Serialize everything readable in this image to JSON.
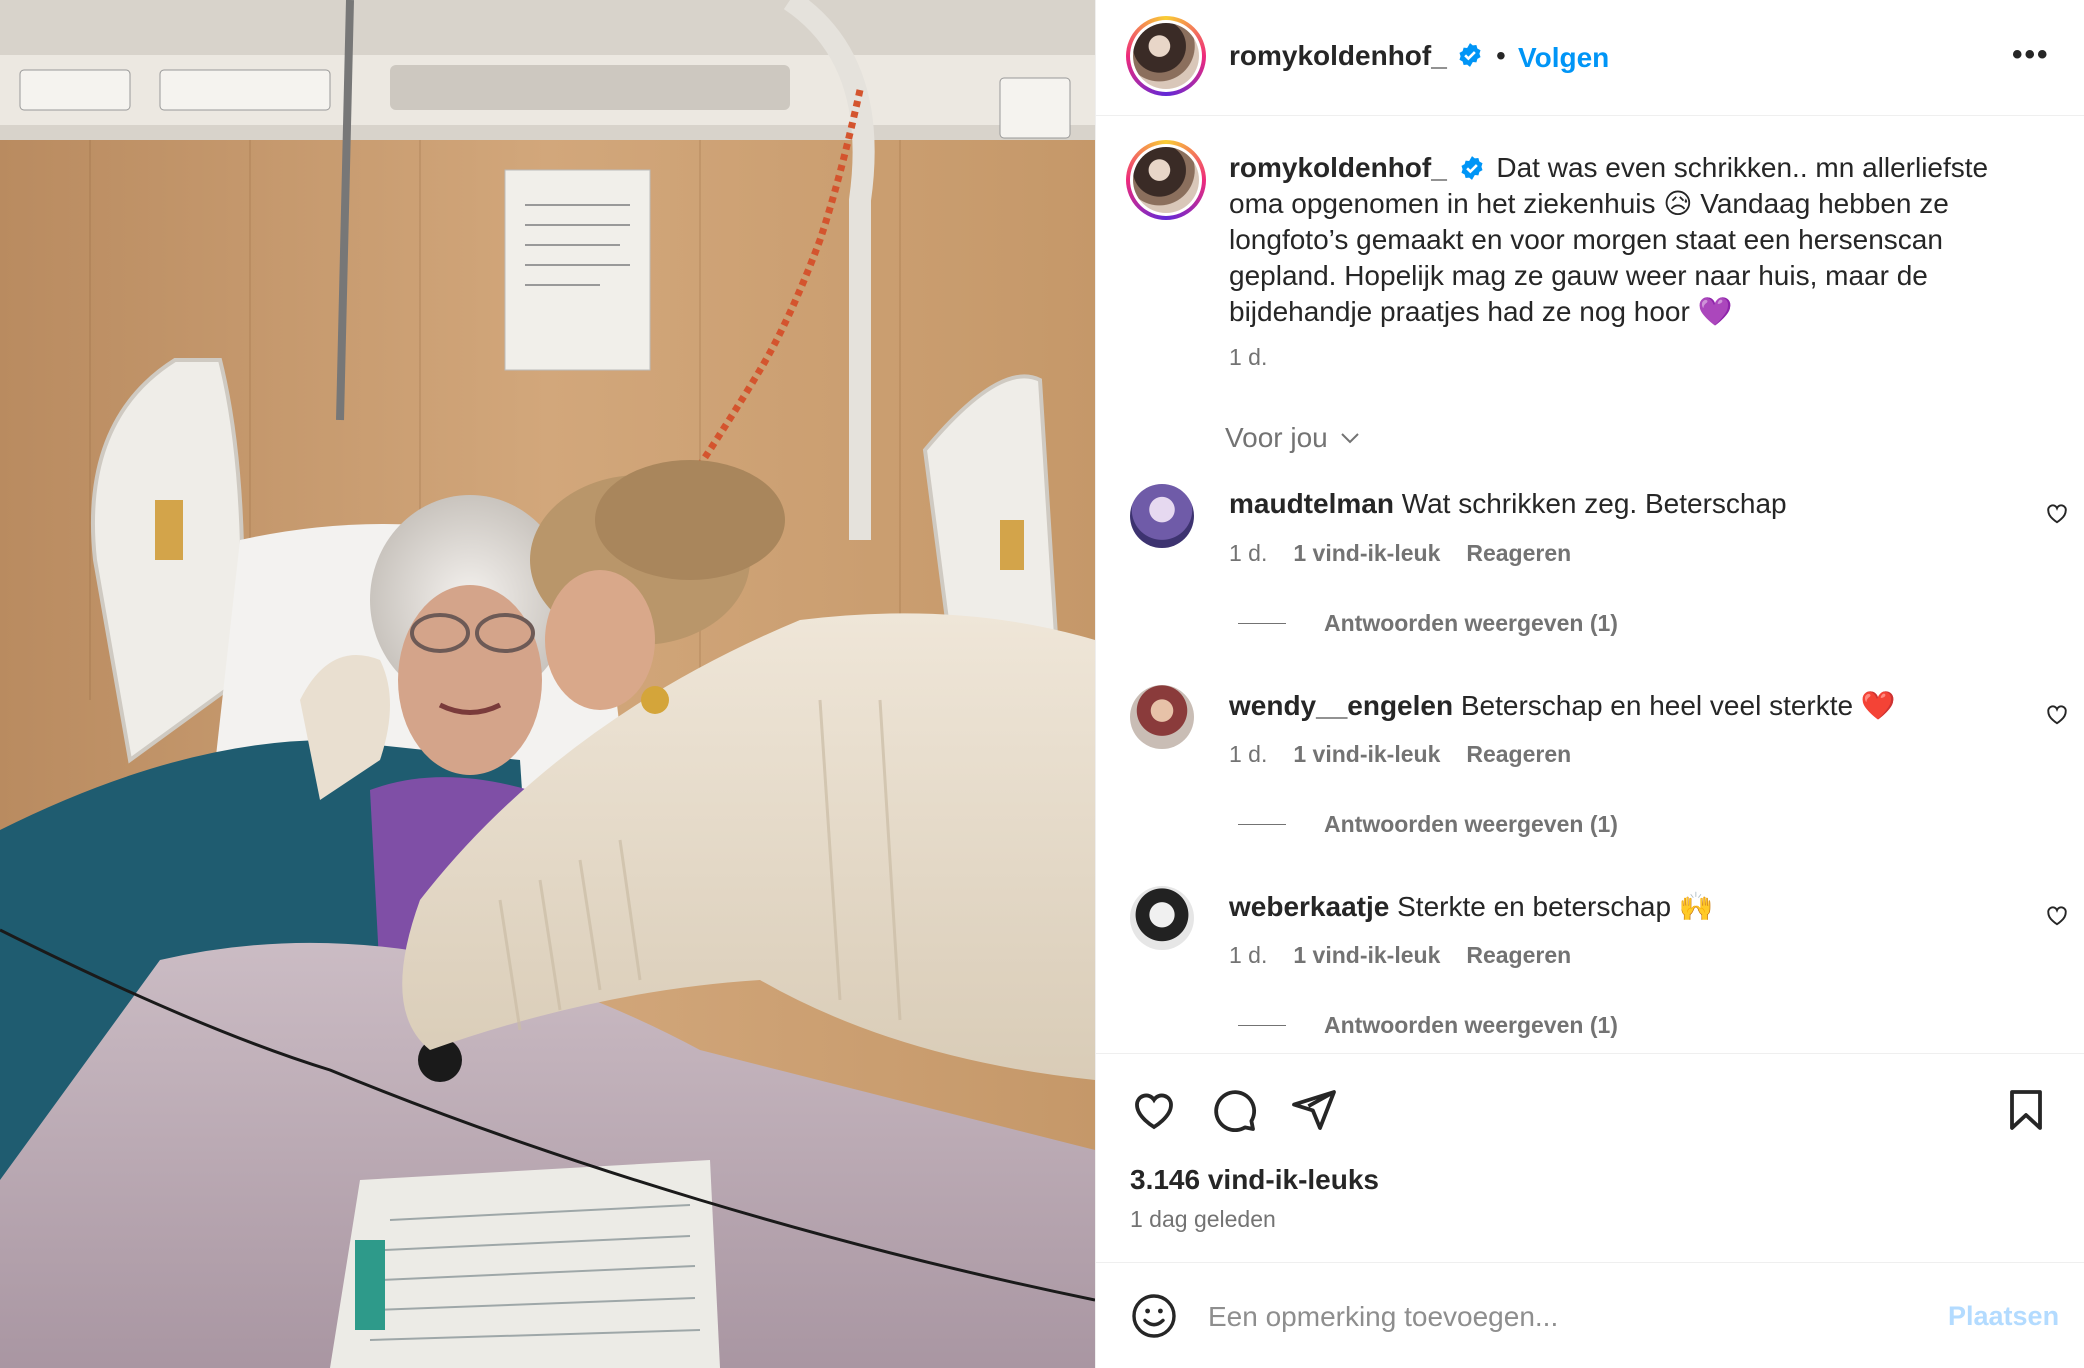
{
  "post": {
    "username": "romykoldenhof_",
    "follow_label": "Volgen",
    "dot": "•",
    "more_label": "•••",
    "caption_text": "Dat was even schrikken.. mn allerliefste oma opgenomen in het ziekenhuis 😥 Vandaag hebben ze longfoto’s gemaakt en voor morgen staat een hersenscan gepland. Hopelijk mag ze gauw weer naar huis, maar de bijdehandje praatjes had ze nog hoor 💜",
    "caption_time": "1 d.",
    "for_you_label": "Voor jou",
    "likes": "3.146 vind-ik-leuks",
    "posted_ago": "1 dag geleden"
  },
  "comments": [
    {
      "username": "maudtelman",
      "text": "Wat schrikken zeg. Beterschap",
      "time": "1 d.",
      "likes": "1 vind-ik-leuk",
      "reply": "Reageren",
      "view_replies": "Antwoorden weergeven (1)"
    },
    {
      "username": "wendy__engelen",
      "text": "Beterschap en heel veel sterkte ❤️",
      "time": "1 d.",
      "likes": "1 vind-ik-leuk",
      "reply": "Reageren",
      "view_replies": "Antwoorden weergeven (1)"
    },
    {
      "username": "weberkaatje",
      "text": "Sterkte en beterschap 🙌",
      "time": "1 d.",
      "likes": "1 vind-ik-leuk",
      "reply": "Reageren",
      "view_replies": "Antwoorden weergeven (1)"
    }
  ],
  "composer": {
    "placeholder": "Een opmerking toevoegen...",
    "post_label": "Plaatsen"
  },
  "colors": {
    "link_blue": "#0095f6",
    "verified_blue": "#0095f6",
    "secondary_text": "#737373",
    "disabled_post": "#b3dbff"
  },
  "icons": [
    "heart-icon",
    "comment-icon",
    "share-icon",
    "bookmark-icon",
    "emoji-icon",
    "verified-badge-icon",
    "chevron-down-icon",
    "more-icon"
  ]
}
